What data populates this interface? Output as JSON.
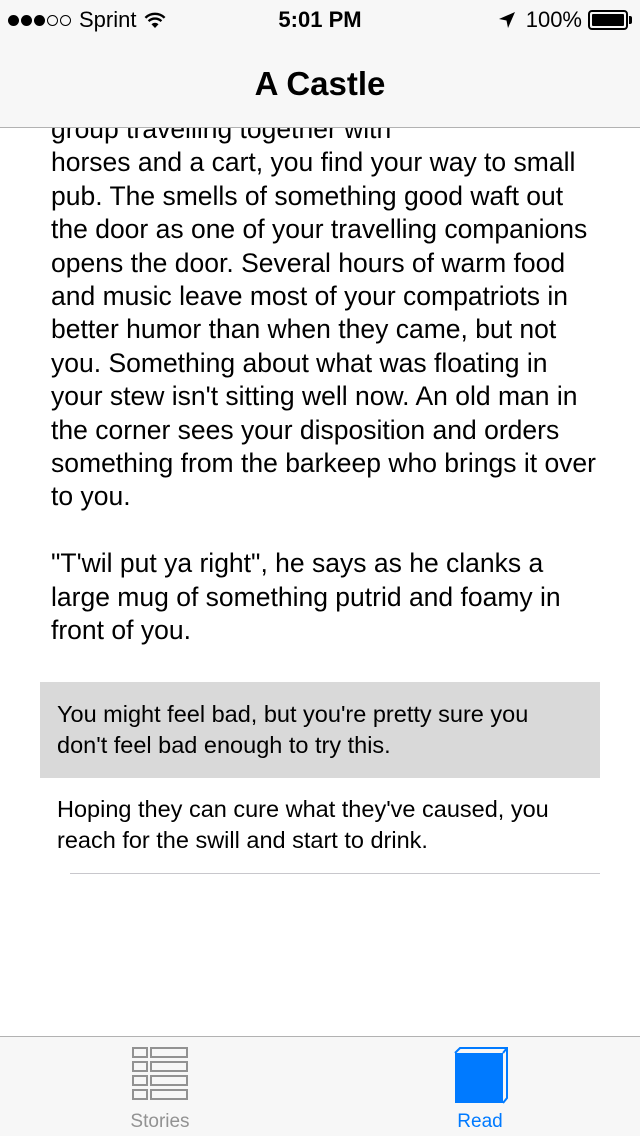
{
  "status_bar": {
    "carrier": "Sprint",
    "time": "5:01 PM",
    "battery_percent": "100%",
    "signal_bars_full": 3,
    "signal_bars_total": 5,
    "battery_level": 1.0
  },
  "nav": {
    "title": "A Castle"
  },
  "story": {
    "partial_line": "group travelling together with",
    "paragraph_1": "horses and a cart, you find your way to small pub. The smells of something good waft out the door as one of your travelling companions opens the door. Several hours of warm food and music leave most of your compatriots in better humor than when they came, but not you. Something about what was floating in your stew isn't sitting well now. An old man in the corner sees your disposition and orders something from the barkeep who brings it over to you.",
    "paragraph_2": "\"T'wil put ya right\", he says as he clanks a large mug of something putrid and foamy in front of you."
  },
  "choices": [
    {
      "text": "You might feel bad, but you're pretty sure you don't feel bad enough to try this."
    },
    {
      "text": "Hoping they can cure what they've caused, you reach for the swill and start to drink."
    }
  ],
  "tabs": [
    {
      "label": "Stories",
      "icon": "list-icon",
      "selected": false
    },
    {
      "label": "Read",
      "icon": "book-icon",
      "selected": true
    }
  ],
  "colors": {
    "accent": "#007aff",
    "inactive_tab": "#929292",
    "bar_background": "#f7f7f7",
    "selected_choice_background": "#d9d9d9"
  }
}
